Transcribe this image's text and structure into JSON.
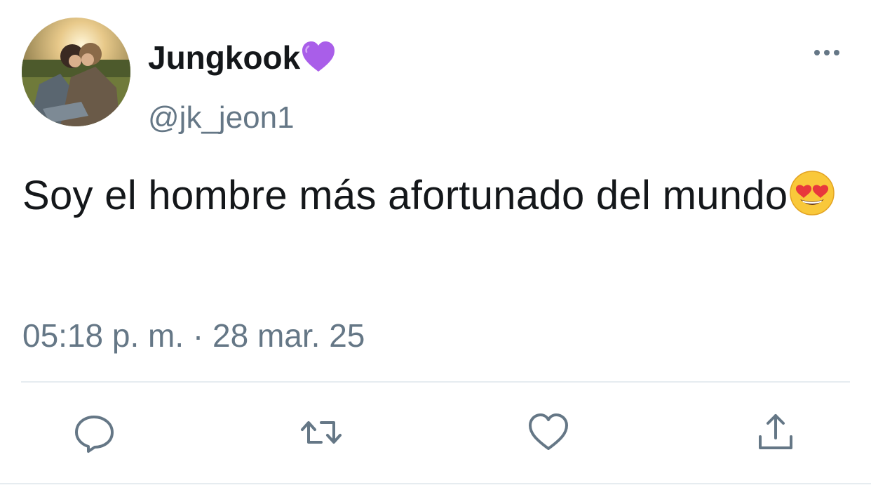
{
  "user": {
    "display_name": "Jungkook",
    "badge_icon": "purple-heart-icon",
    "badge_color": "#a95ee9",
    "handle": "@jk_jeon1"
  },
  "tweet": {
    "text": "Soy el hombre más afortunado del mundo",
    "trailing_emoji": "heart-eyes-emoji",
    "timestamp": "05:18 p. m. · 28 mar. 25"
  },
  "actions": [
    {
      "name": "reply",
      "icon": "reply-icon"
    },
    {
      "name": "retweet",
      "icon": "retweet-icon"
    },
    {
      "name": "like",
      "icon": "heart-outline-icon"
    },
    {
      "name": "share",
      "icon": "share-icon"
    }
  ],
  "colors": {
    "text": "#14171a",
    "secondary": "#657786",
    "divider": "#e6ecf0"
  }
}
